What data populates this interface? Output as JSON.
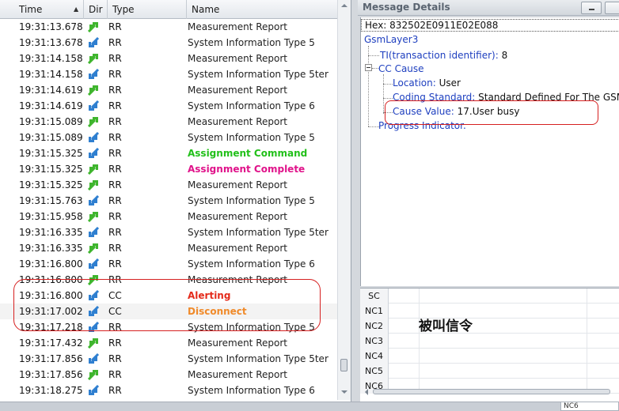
{
  "log": {
    "headers": {
      "time": "Time",
      "dir": "Dir",
      "type": "Type",
      "name": "Name"
    },
    "rows": [
      {
        "time": "19:31:13.678",
        "dir": "up",
        "type": "RR",
        "name": "Measurement Report",
        "style": ""
      },
      {
        "time": "19:31:13.678",
        "dir": "down",
        "type": "RR",
        "name": "System Information Type 5",
        "style": ""
      },
      {
        "time": "19:31:14.158",
        "dir": "up",
        "type": "RR",
        "name": "Measurement Report",
        "style": ""
      },
      {
        "time": "19:31:14.158",
        "dir": "down",
        "type": "RR",
        "name": "System Information Type 5ter",
        "style": ""
      },
      {
        "time": "19:31:14.619",
        "dir": "up",
        "type": "RR",
        "name": "Measurement Report",
        "style": ""
      },
      {
        "time": "19:31:14.619",
        "dir": "down",
        "type": "RR",
        "name": "System Information Type 6",
        "style": ""
      },
      {
        "time": "19:31:15.089",
        "dir": "up",
        "type": "RR",
        "name": "Measurement Report",
        "style": ""
      },
      {
        "time": "19:31:15.089",
        "dir": "down",
        "type": "RR",
        "name": "System Information Type 5",
        "style": ""
      },
      {
        "time": "19:31:15.325",
        "dir": "down",
        "type": "RR",
        "name": "Assignment Command",
        "style": "green"
      },
      {
        "time": "19:31:15.325",
        "dir": "up",
        "type": "RR",
        "name": "Assignment Complete",
        "style": "magenta"
      },
      {
        "time": "19:31:15.325",
        "dir": "up",
        "type": "RR",
        "name": "Measurement Report",
        "style": ""
      },
      {
        "time": "19:31:15.763",
        "dir": "down",
        "type": "RR",
        "name": "System Information Type 5",
        "style": ""
      },
      {
        "time": "19:31:15.958",
        "dir": "up",
        "type": "RR",
        "name": "Measurement Report",
        "style": ""
      },
      {
        "time": "19:31:16.335",
        "dir": "down",
        "type": "RR",
        "name": "System Information Type 5ter",
        "style": ""
      },
      {
        "time": "19:31:16.335",
        "dir": "up",
        "type": "RR",
        "name": "Measurement Report",
        "style": ""
      },
      {
        "time": "19:31:16.800",
        "dir": "down",
        "type": "RR",
        "name": "System Information Type 6",
        "style": ""
      },
      {
        "time": "19:31:16.800",
        "dir": "up",
        "type": "RR",
        "name": "Measurement Report",
        "style": ""
      },
      {
        "time": "19:31:16.800",
        "dir": "down",
        "type": "CC",
        "name": "Alerting",
        "style": "red"
      },
      {
        "time": "19:31:17.002",
        "dir": "down",
        "type": "CC",
        "name": "Disconnect",
        "style": "orange"
      },
      {
        "time": "19:31:17.218",
        "dir": "down",
        "type": "RR",
        "name": "System Information Type 5",
        "style": ""
      },
      {
        "time": "19:31:17.432",
        "dir": "up",
        "type": "RR",
        "name": "Measurement Report",
        "style": ""
      },
      {
        "time": "19:31:17.856",
        "dir": "down",
        "type": "RR",
        "name": "System Information Type 5ter",
        "style": ""
      },
      {
        "time": "19:31:17.856",
        "dir": "up",
        "type": "RR",
        "name": "Measurement Report",
        "style": ""
      },
      {
        "time": "19:31:18.275",
        "dir": "down",
        "type": "RR",
        "name": "System Information Type 6",
        "style": ""
      }
    ]
  },
  "details": {
    "title": "Message Details",
    "hex_label": "Hex:",
    "hex_value": "832502E0911E02E088",
    "root": "GsmLayer3",
    "ti_label": "TI(transaction identifier):",
    "ti_value": "8",
    "cc_cause": "CC Cause",
    "location_label": "Location:",
    "location_value": "User",
    "coding_label": "Coding Standard:",
    "coding_value": "Standard Defined For The GSM PL",
    "cause_label": "Cause Value:",
    "cause_value": "17.User busy",
    "progress": "Progress Indicator."
  },
  "grid": {
    "rows": [
      "SC",
      "NC1",
      "NC2",
      "NC3",
      "NC4",
      "NC5",
      "NC6"
    ],
    "tail_label": "NC6"
  },
  "annotation": {
    "text": "被叫信令"
  },
  "colors": {
    "accent_red": "#d62020",
    "up_arrow": "#3fb52e",
    "down_arrow": "#2f7fd0"
  }
}
